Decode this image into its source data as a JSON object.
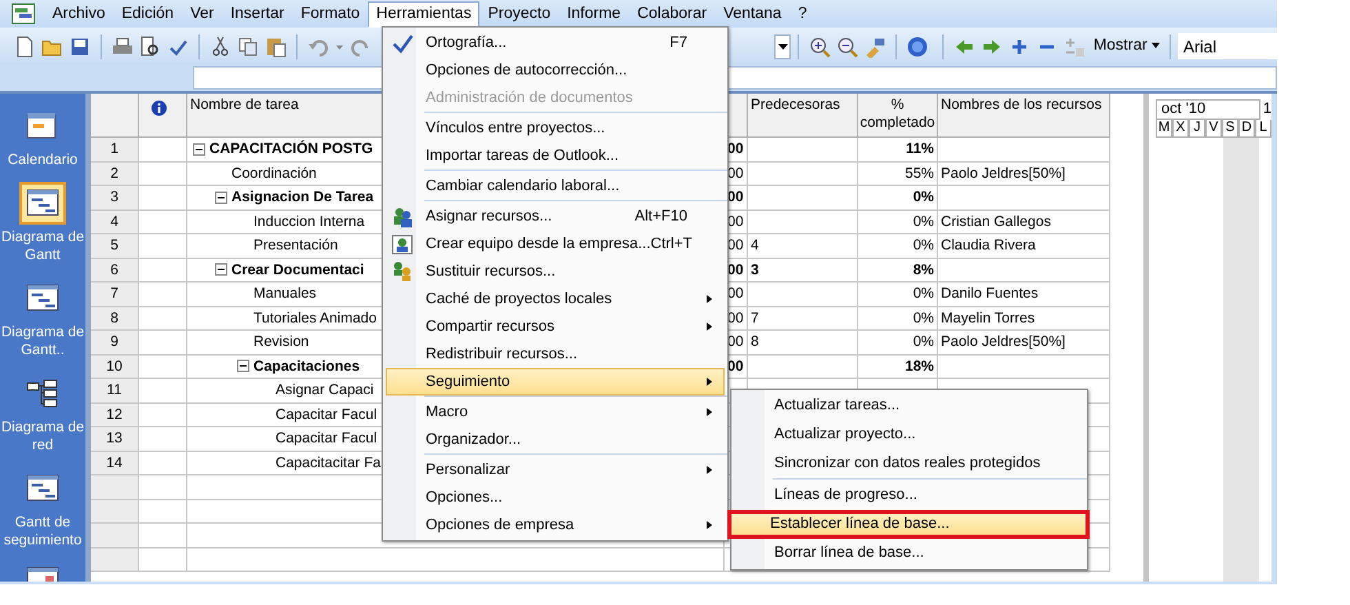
{
  "menu_bar": {
    "items": [
      {
        "label": "Archivo",
        "selected": false
      },
      {
        "label": "Edición",
        "selected": false
      },
      {
        "label": "Ver",
        "selected": false
      },
      {
        "label": "Insertar",
        "selected": false
      },
      {
        "label": "Formato",
        "selected": false
      },
      {
        "label": "Herramientas",
        "selected": true
      },
      {
        "label": "Proyecto",
        "selected": false
      },
      {
        "label": "Informe",
        "selected": false
      },
      {
        "label": "Colaborar",
        "selected": false
      },
      {
        "label": "Ventana",
        "selected": false
      },
      {
        "label": "?",
        "selected": false
      }
    ]
  },
  "toolbar": {
    "show_button": "Mostrar",
    "font_field": {
      "value": "Arial"
    }
  },
  "view_bar": {
    "items": [
      {
        "kind": "calendar",
        "label": "Calendario",
        "selected": false
      },
      {
        "kind": "gantt",
        "label": "Diagrama de Gantt",
        "selected": true
      },
      {
        "kind": "gantt",
        "label": "Diagrama de Gantt..",
        "selected": false
      },
      {
        "kind": "network",
        "label": "Diagrama de red",
        "selected": false
      },
      {
        "kind": "gantt",
        "label": "Gantt de seguimiento",
        "selected": false
      }
    ]
  },
  "table": {
    "columns": [
      "Nombre de tarea",
      "Predecesoras",
      "% completado",
      "Nombres de los recursos"
    ],
    "rows": [
      {
        "id": "1",
        "name": "CAPACITACIÓN POSTG",
        "summary": true,
        "expanded": true,
        "column_4": "00",
        "percent": "11%",
        "children": [
          {
            "id": "2",
            "name": "Coordinación",
            "summary": false,
            "column_4": "00",
            "percent": "55%",
            "resources": "Paolo Jeldres[50%]"
          },
          {
            "id": "3",
            "name": "Asignacion De Tarea",
            "summary": true,
            "expanded": true,
            "column_4": "00",
            "percent": "0%",
            "children": [
              {
                "id": "4",
                "name": "Induccion Interna",
                "summary": false,
                "column_4": "00",
                "percent": "0%",
                "resources": "Cristian Gallegos"
              },
              {
                "id": "5",
                "name": "Presentación",
                "summary": false,
                "column_4": "00",
                "predecessors": "4",
                "percent": "0%",
                "resources": "Claudia Rivera"
              }
            ]
          },
          {
            "id": "6",
            "name": "Crear Documentaci",
            "summary": true,
            "expanded": true,
            "column_4": "00",
            "predecessors": "3",
            "percent": "8%",
            "children": [
              {
                "id": "7",
                "name": "Manuales",
                "summary": false,
                "column_4": "00",
                "percent": "0%",
                "resources": "Danilo Fuentes"
              },
              {
                "id": "8",
                "name": "Tutoriales Animado",
                "summary": false,
                "column_4": "00",
                "predecessors": "7",
                "percent": "0%",
                "resources": "Mayelin Torres"
              },
              {
                "id": "9",
                "name": "Revision",
                "summary": false,
                "column_4": "00",
                "predecessors": "8",
                "percent": "0%",
                "resources": "Paolo Jeldres[50%]"
              },
              {
                "id": "10",
                "name": "Capacitaciones",
                "summary": true,
                "expanded": true,
                "column_4": "00",
                "percent": "18%",
                "children": [
                  {
                    "id": "11",
                    "name": "Asignar Capaci",
                    "summary": false
                  },
                  {
                    "id": "12",
                    "name": "Capacitar Facul",
                    "summary": false
                  },
                  {
                    "id": "13",
                    "name": "Capacitar Facul",
                    "summary": false
                  },
                  {
                    "id": "14",
                    "name": "Capacitacitar Fa",
                    "summary": false
                  }
                ]
              }
            ]
          }
        ]
      }
    ]
  },
  "timescale": {
    "month": "oct '10",
    "next": "1",
    "days": [
      "M",
      "X",
      "J",
      "V",
      "S",
      "D",
      "L"
    ]
  },
  "tools_menu": {
    "items": [
      {
        "kind": "item",
        "label": "Ortografía...",
        "shortcut": "F7",
        "disabled": false,
        "selected": false,
        "submenu": false
      },
      {
        "kind": "item",
        "label": "Opciones de autocorrección...",
        "disabled": false,
        "selected": false,
        "submenu": false
      },
      {
        "kind": "item",
        "label": "Administración de documentos",
        "disabled": true,
        "selected": false,
        "submenu": false
      },
      {
        "kind": "separator"
      },
      {
        "kind": "item",
        "label": "Vínculos entre proyectos...",
        "disabled": false,
        "selected": false,
        "submenu": false
      },
      {
        "kind": "item",
        "label": "Importar tareas de Outlook...",
        "disabled": false,
        "selected": false,
        "submenu": false
      },
      {
        "kind": "separator"
      },
      {
        "kind": "item",
        "label": "Cambiar calendario laboral...",
        "disabled": false,
        "selected": false,
        "submenu": false
      },
      {
        "kind": "separator"
      },
      {
        "kind": "item",
        "label": "Asignar recursos...",
        "shortcut": "Alt+F10",
        "disabled": false,
        "selected": false,
        "submenu": false
      },
      {
        "kind": "item",
        "label": "Crear equipo desde la empresa...",
        "shortcut": "Ctrl+T",
        "disabled": false,
        "selected": false,
        "submenu": false
      },
      {
        "kind": "item",
        "label": "Sustituir recursos...",
        "disabled": false,
        "selected": false,
        "submenu": false
      },
      {
        "kind": "item",
        "label": "Caché de proyectos locales",
        "disabled": false,
        "selected": false,
        "submenu": true
      },
      {
        "kind": "item",
        "label": "Compartir recursos",
        "disabled": false,
        "selected": false,
        "submenu": true
      },
      {
        "kind": "item",
        "label": "Redistribuir recursos...",
        "disabled": false,
        "selected": false,
        "submenu": false
      },
      {
        "kind": "item",
        "label": "Seguimiento",
        "disabled": false,
        "selected": true,
        "submenu": true
      },
      {
        "kind": "separator"
      },
      {
        "kind": "item",
        "label": "Macro",
        "disabled": false,
        "selected": false,
        "submenu": true
      },
      {
        "kind": "item",
        "label": "Organizador...",
        "disabled": false,
        "selected": false,
        "submenu": false
      },
      {
        "kind": "separator"
      },
      {
        "kind": "item",
        "label": "Personalizar",
        "disabled": false,
        "selected": false,
        "submenu": true
      },
      {
        "kind": "item",
        "label": "Opciones...",
        "disabled": false,
        "selected": false,
        "submenu": false
      },
      {
        "kind": "item",
        "label": "Opciones de empresa",
        "disabled": false,
        "selected": false,
        "submenu": true
      }
    ]
  },
  "tracking_submenu": {
    "items": [
      {
        "kind": "item",
        "label": "Actualizar tareas...",
        "selected": false,
        "annotated": false
      },
      {
        "kind": "item",
        "label": "Actualizar proyecto...",
        "selected": false,
        "annotated": false
      },
      {
        "kind": "item",
        "label": "Sincronizar con datos reales protegidos",
        "selected": false,
        "annotated": false
      },
      {
        "kind": "separator"
      },
      {
        "kind": "item",
        "label": "Líneas de progreso...",
        "selected": false,
        "annotated": false
      },
      {
        "kind": "item",
        "label": "Establecer línea de base...",
        "selected": true,
        "annotated": true
      },
      {
        "kind": "item",
        "label": "Borrar línea de base...",
        "selected": false,
        "annotated": false
      }
    ]
  }
}
